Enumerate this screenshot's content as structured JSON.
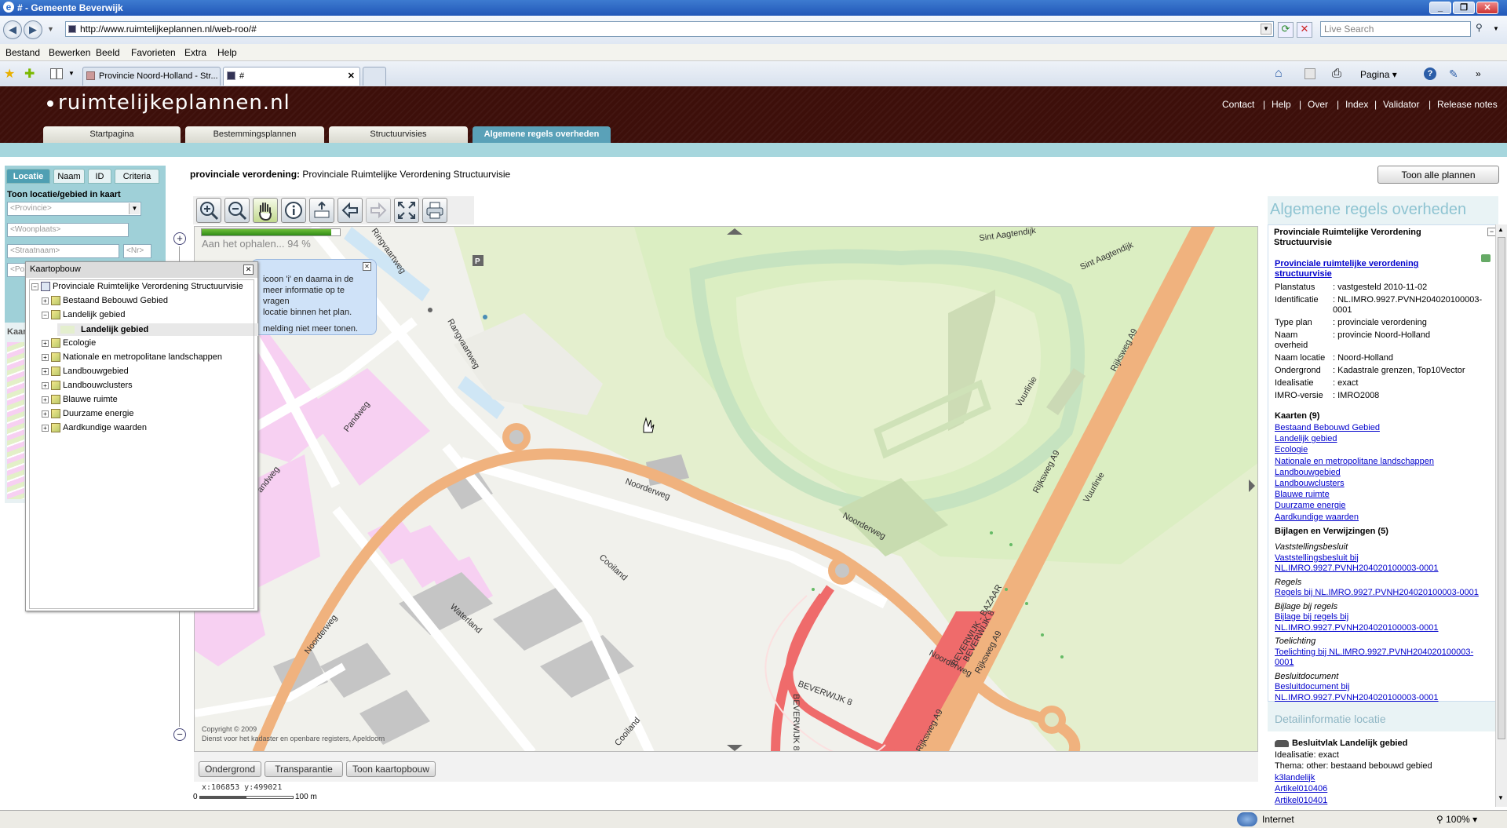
{
  "browser": {
    "title": "# - Gemeente Beverwijk",
    "url": "http://www.ruimtelijkeplannen.nl/web-roo/#",
    "search_placeholder": "Live Search",
    "menu": [
      "Bestand",
      "Bewerken",
      "Beeld",
      "Favorieten",
      "Extra",
      "Help"
    ],
    "tabs": [
      "Provincie Noord-Holland - Str...",
      "#"
    ],
    "toolbar_page": "Pagina",
    "status_zone": "Internet",
    "zoom": "100%"
  },
  "site": {
    "logo": "ruimtelijkeplannen.nl",
    "top_links": [
      "Contact",
      "Help",
      "Over",
      "Index",
      "Validator",
      "Release notes"
    ],
    "tabs": [
      "Startpagina",
      "Bestemmingsplannen",
      "Structuurvisies",
      "Algemene regels overheden"
    ],
    "active_tab": "Algemene regels overheden"
  },
  "left_panel": {
    "tabs": [
      "Locatie",
      "Naam",
      "ID",
      "Criteria"
    ],
    "heading": "Toon locatie/gebied in kaart",
    "provincie_placeholder": "<Provincie>",
    "woonplaats_placeholder": "<Woonplaats>",
    "straatnaam_placeholder": "<Straatnaam>",
    "nr_placeholder": "<Nr>",
    "po_placeholder": "<Po",
    "lower_label": "Kaar"
  },
  "kaartopbouw": {
    "title": "Kaartopbouw",
    "root": "Provinciale Ruimtelijke Verordening Structuurvisie",
    "items": [
      {
        "label": "Bestaand Bebouwd Gebied",
        "expanded": false
      },
      {
        "label": "Landelijk gebied",
        "expanded": true,
        "child": "Landelijk gebied"
      },
      {
        "label": "Ecologie",
        "expanded": false
      },
      {
        "label": "Nationale en metropolitane landschappen",
        "expanded": false
      },
      {
        "label": "Landbouwgebied",
        "expanded": false
      },
      {
        "label": "Landbouwclusters",
        "expanded": false
      },
      {
        "label": "Blauwe ruimte",
        "expanded": false
      },
      {
        "label": "Duurzame energie",
        "expanded": false
      },
      {
        "label": "Aardkundige waarden",
        "expanded": false
      }
    ]
  },
  "map_header": {
    "prefix": "provinciale verordening:",
    "name": "Provinciale Ruimtelijke Verordening Structuurvisie",
    "show_all_button": "Toon alle plannen"
  },
  "map": {
    "loading_text": "Aan het ophalen... 94 %",
    "loading_progress": 0.94,
    "bubble_lines": [
      "icoon 'i' en daarna in de",
      "meer informatie op te vragen",
      "locatie binnen het plan.",
      "melding niet meer tonen."
    ],
    "copyright_1": "Copyright © 2009",
    "copyright_2": "Dienst voor het kadaster en openbare registers,  Apeldoorn",
    "coords": "x:106853 y:499021",
    "scale_label": "100 m",
    "scale_zero": "0",
    "street_labels": [
      "Sint Aagtendijk",
      "Sint Aagtendijk",
      "Ringvaartweg",
      "Rangvaartweg",
      "Pandweg",
      "Pandweg",
      "Noorderweg",
      "Noorderweg",
      "Noorderweg",
      "Noorderweg",
      "Cooiland",
      "Cooiland",
      "Waterland",
      "Vuurlinie",
      "Vuurlinie",
      "Rijksweg A9",
      "Rijksweg A9",
      "Rijksweg A9",
      "Rijksweg A9",
      "BEVERWIJK 8",
      "BEVERWIJK 8",
      "BEVERWIJK - BAZAAR",
      "BEVERWIJK 8",
      "P"
    ],
    "bottom_buttons": [
      "Ondergrond",
      "Transparantie",
      "Toon kaartopbouw"
    ]
  },
  "right_panel": {
    "heading": "Algemene regels overheden",
    "plan_title": "Provinciale Ruimtelijke Verordening Structuurvisie",
    "plan_link": "Provinciale ruimtelijke verordening structuurvisie",
    "properties": [
      {
        "key": "Planstatus",
        "value": ": vastgesteld 2010-11-02"
      },
      {
        "key": "Identificatie",
        "value": ": NL.IMRO.9927.PVNH204020100003-0001"
      },
      {
        "key": "Type plan",
        "value": ": provinciale verordening"
      },
      {
        "key": "Naam overheid",
        "value": ": provincie Noord-Holland"
      },
      {
        "key": "Naam locatie",
        "value": ": Noord-Holland"
      },
      {
        "key": "Ondergrond",
        "value": ": Kadastrale grenzen, Top10Vector"
      },
      {
        "key": "Idealisatie",
        "value": ": exact"
      },
      {
        "key": "IMRO-versie",
        "value": ": IMRO2008"
      }
    ],
    "kaarten_heading": "Kaarten (9)",
    "kaarten": [
      "Bestaand Bebouwd Gebied",
      "Landelijk gebied",
      "Ecologie",
      "Nationale en metropolitane landschappen",
      "Landbouwgebied",
      "Landbouwclusters",
      "Blauwe ruimte",
      "Duurzame energie",
      "Aardkundige waarden"
    ],
    "bijlagen_heading": "Bijlagen en Verwijzingen (5)",
    "bijlagen": [
      {
        "type": "Vaststellingsbesluit",
        "link": "Vaststellingsbesluit bij NL.IMRO.9927.PVNH204020100003-0001"
      },
      {
        "type": "Regels",
        "link": "Regels bij NL.IMRO.9927.PVNH204020100003-0001"
      },
      {
        "type": "Bijlage bij regels",
        "link": "Bijlage bij regels bij NL.IMRO.9927.PVNH204020100003-0001"
      },
      {
        "type": "Toelichting",
        "link": "Toelichting bij NL.IMRO.9927.PVNH204020100003-0001"
      },
      {
        "type": "Besluitdocument",
        "link": "Besluitdocument bij NL.IMRO.9927.PVNH204020100003-0001"
      }
    ],
    "detail_heading": "Detailinformatie locatie",
    "besluitvlak_title": "Besluitvlak Landelijk gebied",
    "besluitvlak_lines": [
      "Idealisatie: exact",
      "Thema: other: bestaand bebouwd gebied"
    ],
    "besluitvlak_links": [
      "k3landelijk",
      "Artikel010406",
      "Artikel010401"
    ]
  },
  "colors": {
    "header_brown": "#3d0f0a",
    "tab_active": "#5aa1b8",
    "road_orange": "#f0b27e",
    "motorway_red": "#ef6b6b",
    "green_area": "#e3f0c8",
    "building_pink": "#f7d0f2",
    "building_gray": "#bcbcbc"
  }
}
